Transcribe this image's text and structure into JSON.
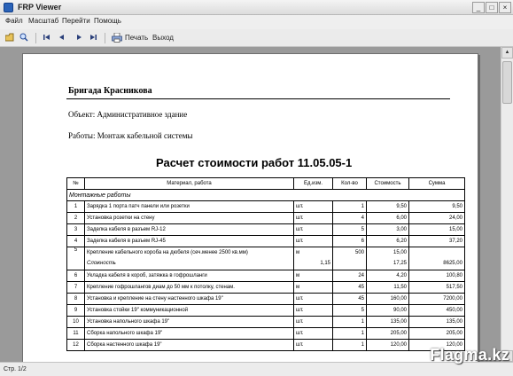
{
  "window": {
    "title": "FRP Viewer"
  },
  "menu": [
    {
      "label": "Файл"
    },
    {
      "label": "Масштаб"
    },
    {
      "label": "Перейти"
    },
    {
      "label": "Помощь"
    }
  ],
  "toolbar": {
    "print_label": "Печать",
    "exit_label": "Выход"
  },
  "document": {
    "brigade": "Бригада Красникова",
    "object": "Объект: Административное здание",
    "work": "Работы: Монтаж кабельной системы",
    "title": "Расчет стоимости работ 11.05.05-1",
    "headers": [
      "№",
      "Материал, работа",
      "Ед.изм.",
      "Кол-во",
      "Стоимость",
      "Сумма"
    ],
    "section": "Монтажные работы",
    "rows": [
      {
        "n": "1",
        "name": "Зарядка 1 порта патч панели или розетки",
        "unit": "шт.",
        "qty": "1",
        "price": "9,50",
        "sum": "9,50"
      },
      {
        "n": "2",
        "name": "Установка розетки на стену",
        "unit": "шт.",
        "qty": "4",
        "price": "6,00",
        "sum": "24,00"
      },
      {
        "n": "3",
        "name": "Заделка кабеля в разъем RJ-12",
        "unit": "шт.",
        "qty": "5",
        "price": "3,00",
        "sum": "15,00"
      },
      {
        "n": "4",
        "name": "Заделка кабеля в разъем RJ-45",
        "unit": "шт.",
        "qty": "6",
        "price": "6,20",
        "sum": "37,20"
      },
      {
        "n": "5",
        "name": "Крепление кабельного короба на дюбеля (сеч.менее 2500 кв.мм)",
        "name2": "Сложность",
        "unit": "м",
        "unit2": "1,15",
        "qty": "500",
        "price": "15,00",
        "price2": "17,25",
        "sum2": "8625,00"
      },
      {
        "n": "6",
        "name": "Укладка кабеля в короб, затяжка в гофрошланги",
        "unit": "м",
        "qty": "24",
        "price": "4,20",
        "sum": "100,80"
      },
      {
        "n": "7",
        "name": "Крепление гофрошлангов диам до 50 мм к потолку, стенам.",
        "unit": "м",
        "qty": "45",
        "price": "11,50",
        "sum": "517,50"
      },
      {
        "n": "8",
        "name": "Установка и крепление на стену настенного шкафа 19\"",
        "unit": "шт.",
        "qty": "45",
        "price": "160,00",
        "sum": "7200,00"
      },
      {
        "n": "9",
        "name": "Установка стойки 19\" коммуникационной",
        "unit": "шт.",
        "qty": "5",
        "price": "90,00",
        "sum": "450,00"
      },
      {
        "n": "10",
        "name": "Установка напольного шкафа 19\"",
        "unit": "шт.",
        "qty": "1",
        "price": "135,00",
        "sum": "135,00"
      },
      {
        "n": "11",
        "name": "Сборка напольного шкафа 19\"",
        "unit": "шт.",
        "qty": "1",
        "price": "205,00",
        "sum": "205,00"
      },
      {
        "n": "12",
        "name": "Сборка настенного шкафа 19\"",
        "unit": "шт.",
        "qty": "1",
        "price": "120,00",
        "sum": "120,00"
      }
    ]
  },
  "status": {
    "page": "Стр. 1/2"
  },
  "watermark": "Flagma.kz"
}
